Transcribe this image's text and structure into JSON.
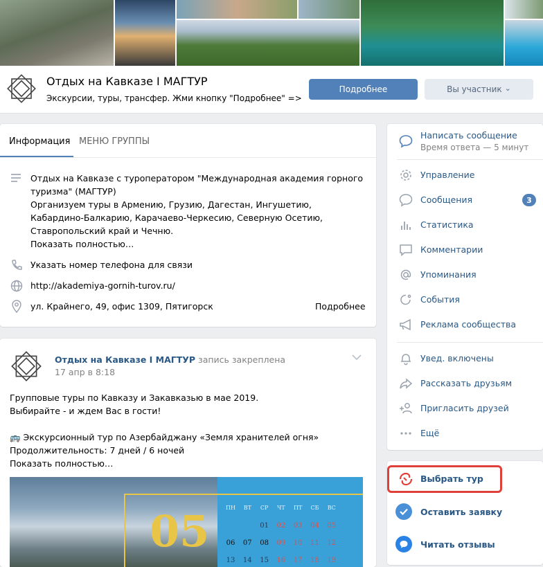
{
  "cover": {
    "photos": [
      "mountain-hikers-photo",
      "mountain-lake-photo",
      "hiker-rocks-photo",
      "green-valley-photo",
      "mountain-forest-church-photo",
      "reflection-lake-photo",
      "pool-group-photo",
      "waterfall-photo",
      "sunset-peaks-photo"
    ]
  },
  "header": {
    "title": "Отдых на Кавказе I МАГТУР",
    "subtitle": "Экскурсии, туры, трансфер. Жми кнопку \"Подробнее\" =>",
    "primary_button": "Подробнее",
    "secondary_button": "Вы участник",
    "secondary_chevron": "⌄"
  },
  "info": {
    "tabs": [
      "Информация",
      "МЕНЮ ГРУППЫ"
    ],
    "description": [
      "Отдых на Кавказе с туроператором \"Международная академия горного",
      "туризма\" (МАГТУР)",
      "Организуем туры в Армению, Грузию, Дагестан, Ингушетию,",
      "Кабардино-Балкарию, Карачаево-Черкесию, Северную Осетию,",
      "Ставропольский край и Чечню."
    ],
    "show_more": "Показать полностью…",
    "phone": "Указать номер телефона для связи",
    "website": "http://akademiya-gornih-turov.ru/",
    "address": "ул. Крайнего, 49, офис 1309, Пятигорск",
    "address_more": "Подробнее"
  },
  "post": {
    "author": "Отдых на Кавказе I МАГТУР",
    "pinned": "запись закреплена",
    "date": "17 апр в 8:18",
    "lines": [
      "Групповые туры по Кавказу и Закавказью в мае 2019.",
      "Выбирайте - и ждем Вас в гости!",
      "",
      "🚌 Экскурсионный тур по Азербайджану «Земля хранителей огня»",
      "Продолжительность: 7 дней / 6 ночей"
    ],
    "show_more": "Показать полностью…",
    "calendar": {
      "month_number": "05",
      "weekdays": [
        "ПН",
        "ВТ",
        "СР",
        "ЧТ",
        "ПТ",
        "СБ",
        "ВС"
      ],
      "row1": [
        "",
        "",
        "01",
        "02",
        "03",
        "04",
        "05"
      ],
      "row2": [
        "06",
        "07",
        "08",
        "09",
        "10",
        "11",
        "12"
      ],
      "row3": [
        "13",
        "14",
        "15",
        "16",
        "17",
        "18",
        "19"
      ]
    }
  },
  "sidebar": {
    "message": {
      "label": "Написать сообщение",
      "sub": "Время ответа — 5 минут"
    },
    "items": [
      {
        "label": "Управление"
      },
      {
        "label": "Сообщения",
        "badge": "3"
      },
      {
        "label": "Статистика"
      },
      {
        "label": "Комментарии"
      },
      {
        "label": "Упоминания"
      },
      {
        "label": "События"
      },
      {
        "label": "Реклама сообщества"
      }
    ],
    "items2": [
      {
        "label": "Увед. включены"
      },
      {
        "label": "Рассказать друзьям"
      },
      {
        "label": "Пригласить друзей"
      },
      {
        "label": "Ещё"
      }
    ],
    "apps": [
      {
        "label": "Выбрать тур"
      },
      {
        "label": "Оставить заявку"
      },
      {
        "label": "Читать отзывы"
      }
    ]
  },
  "colors": {
    "accent": "#5181b8",
    "link": "#2a5885",
    "highlight": "#e0403a",
    "background": "#edeef0"
  }
}
